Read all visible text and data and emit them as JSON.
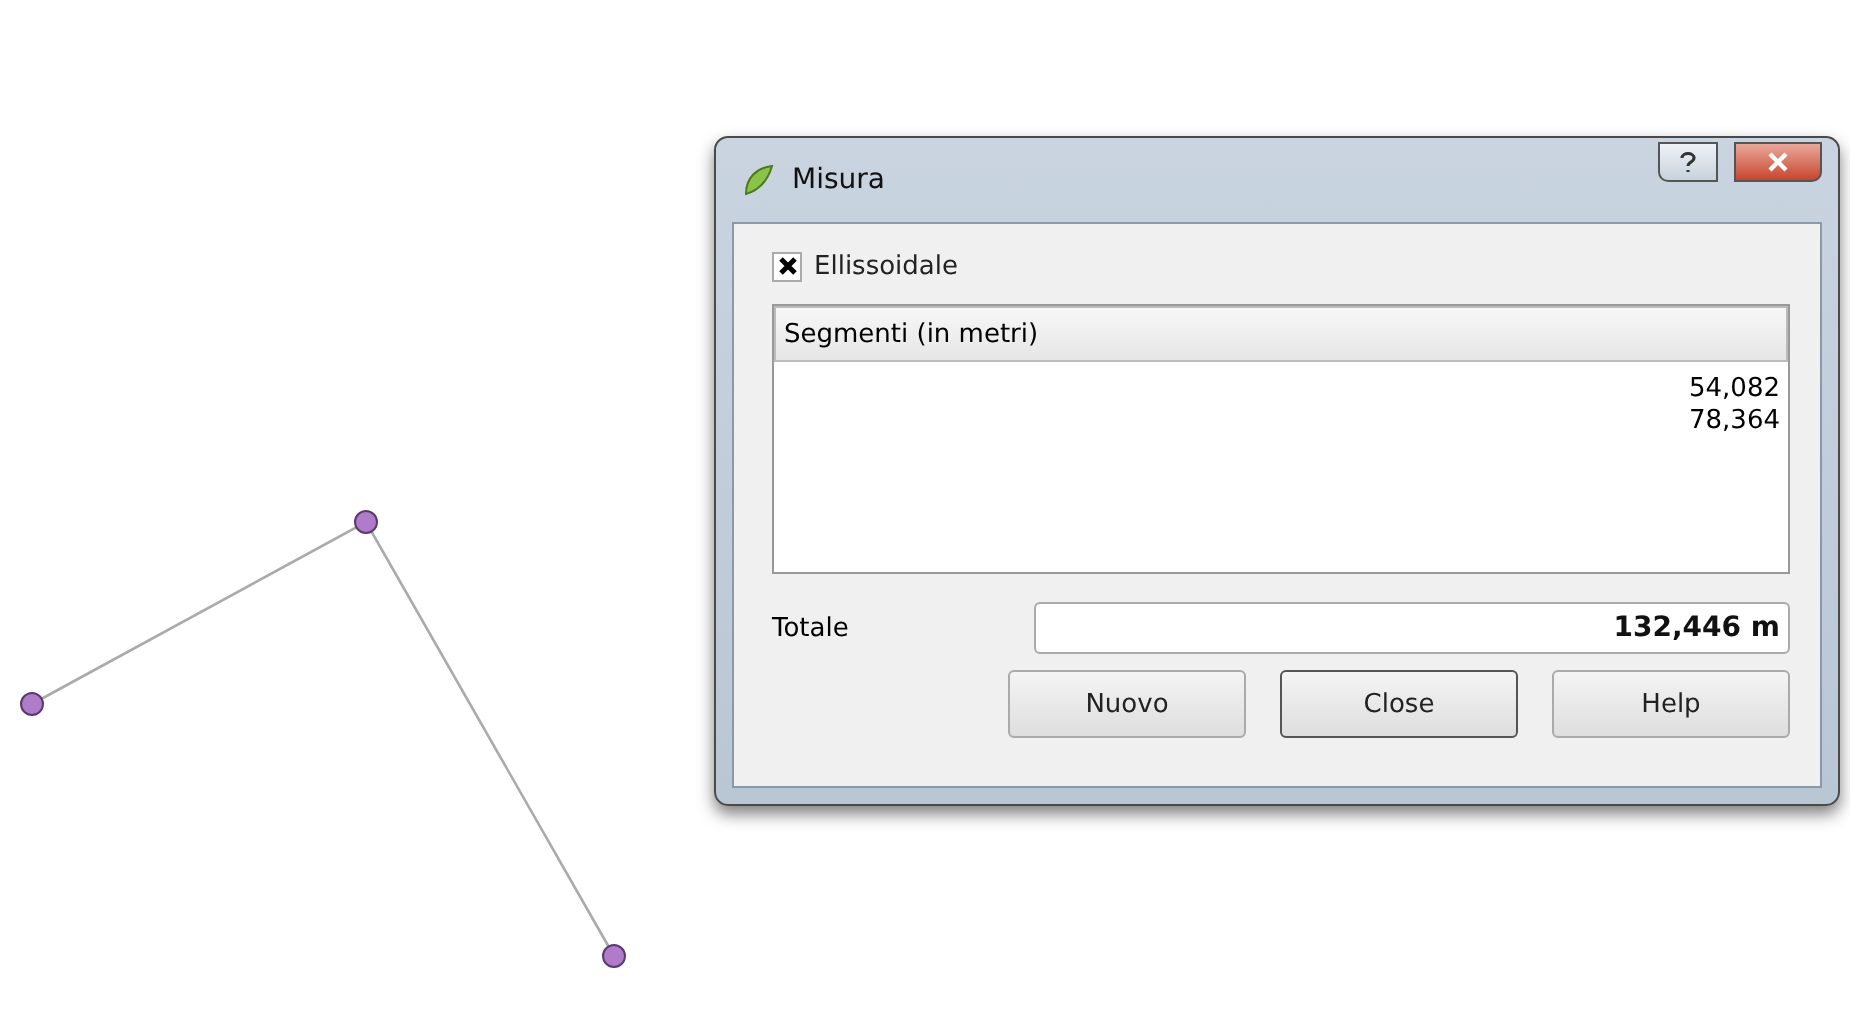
{
  "window": {
    "title": "Misura"
  },
  "ellipsoidal": {
    "label": "Ellissoidale",
    "checked": true
  },
  "segments": {
    "header": "Segmenti (in metri)",
    "rows": [
      "54,082",
      "78,364"
    ]
  },
  "total": {
    "label": "Totale",
    "value": "132,446 m"
  },
  "buttons": [
    {
      "label": "Nuovo",
      "default": false
    },
    {
      "label": "Close",
      "default": true
    },
    {
      "label": "Help",
      "default": false
    }
  ]
}
